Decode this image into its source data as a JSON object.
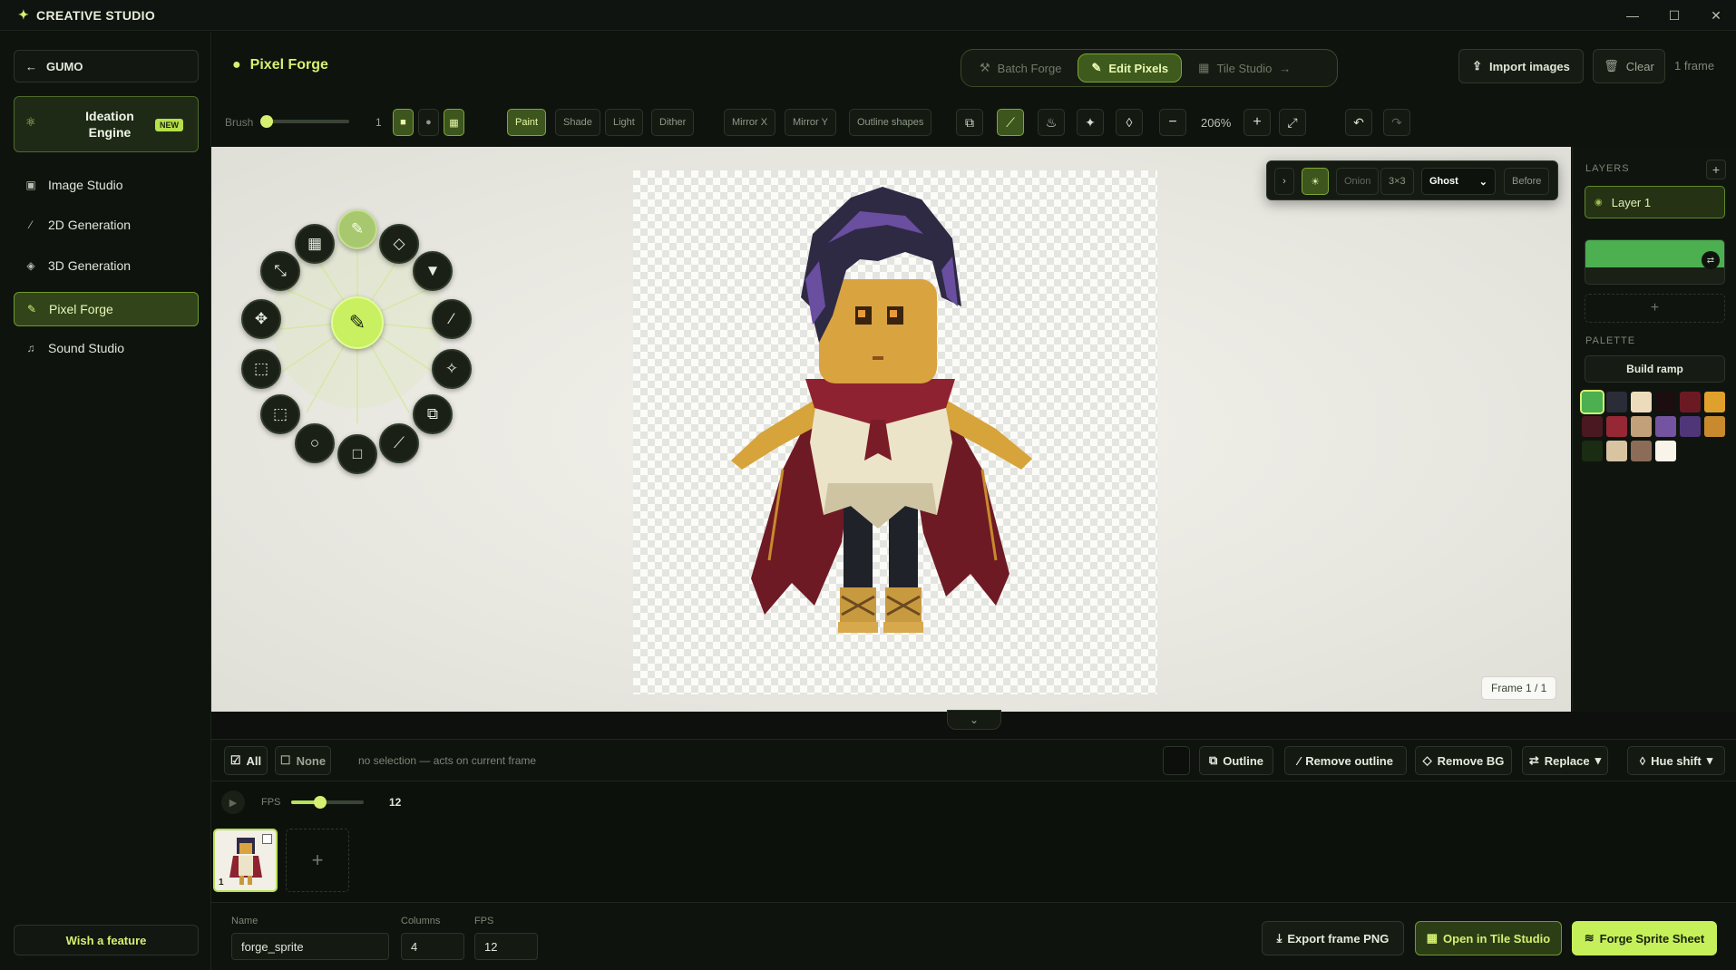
{
  "app": {
    "title": "CREATIVE STUDIO"
  },
  "window": {
    "minimize": "—",
    "maximize": "☐",
    "close": "✕"
  },
  "sidebar": {
    "back_label": "GUMO",
    "ideation": {
      "line1": "Ideation",
      "line2": "Engine",
      "badge": "NEW"
    },
    "items": [
      {
        "label": "Image Studio"
      },
      {
        "label": "2D Generation"
      },
      {
        "label": "3D Generation"
      },
      {
        "label": "Pixel Forge"
      },
      {
        "label": "Sound Studio"
      }
    ],
    "wish": "Wish a feature"
  },
  "header": {
    "title": "Pixel Forge",
    "tabs": [
      {
        "label": "Batch Forge"
      },
      {
        "label": "Edit Pixels"
      },
      {
        "label": "Tile Studio"
      }
    ],
    "import": "Import images",
    "clear": "Clear",
    "frames": "1 frame"
  },
  "toolbar": {
    "brush_label": "Brush",
    "brush_size": "1",
    "modes": [
      "Paint",
      "Shade",
      "Light",
      "Dither"
    ],
    "mirror_x": "Mirror X",
    "mirror_y": "Mirror Y",
    "outline_shapes": "Outline shapes",
    "zoom": "206%"
  },
  "overlay": {
    "onion": "Onion",
    "grid": "3×3",
    "ghost": "Ghost",
    "before": "Before"
  },
  "canvas": {
    "frame_indicator": "Frame 1 / 1"
  },
  "layers": {
    "heading": "LAYERS",
    "layer_name": "Layer 1",
    "palette_heading": "PALETTE",
    "build_ramp": "Build ramp"
  },
  "palette": [
    "#4caf50",
    "#2a2c38",
    "#ecdcbc",
    "#1c0d10",
    "#6b1a24",
    "#e0a02c",
    "#4a1820",
    "#962836",
    "#c2a07a",
    "#7454a0",
    "#4f3678",
    "#c88a2c",
    "#1a2c12",
    "#d8c4a0",
    "#8a6c58",
    "#f8f4ea"
  ],
  "actions": {
    "all": "All",
    "none": "None",
    "hint": "no selection — acts on current frame",
    "outline": "Outline",
    "remove_outline": "Remove outline",
    "remove_bg": "Remove BG",
    "replace": "Replace",
    "hue_shift": "Hue shift"
  },
  "timeline": {
    "fps_label": "FPS",
    "fps_value": "12",
    "frame_number": "1"
  },
  "export": {
    "name_label": "Name",
    "name_value": "forge_sprite",
    "columns_label": "Columns",
    "columns_value": "4",
    "fps_label": "FPS",
    "fps_value": "12",
    "export_png": "Export frame PNG",
    "open_tile": "Open in Tile Studio",
    "forge_sheet": "Forge Sprite Sheet"
  }
}
